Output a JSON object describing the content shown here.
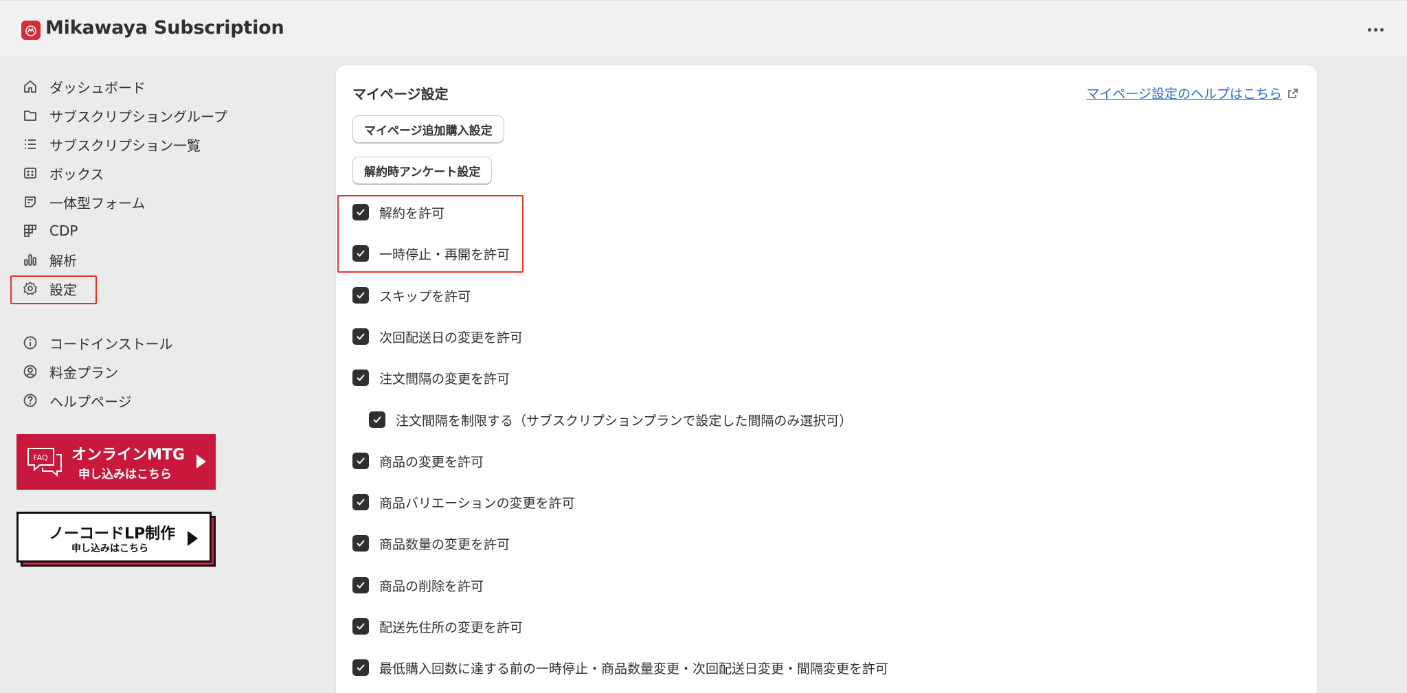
{
  "app": {
    "title": "Mikawaya Subscription",
    "accent_color": "#d32f3a"
  },
  "topbar": {
    "more_icon": "ellipsis-icon"
  },
  "sidebar": {
    "items": [
      {
        "label": "ダッシュボード",
        "icon": "home-icon"
      },
      {
        "label": "サブスクリプショングループ",
        "icon": "folder-icon"
      },
      {
        "label": "サブスクリプション一覧",
        "icon": "list-icon"
      },
      {
        "label": "ボックス",
        "icon": "box-icon"
      },
      {
        "label": "一体型フォーム",
        "icon": "form-icon"
      },
      {
        "label": "CDP",
        "icon": "grid-icon"
      },
      {
        "label": "解析",
        "icon": "bar-chart-icon"
      },
      {
        "label": "設定",
        "icon": "gear-icon",
        "highlighted": true
      },
      {
        "label": "コードインストール",
        "icon": "info-icon"
      },
      {
        "label": "料金プラン",
        "icon": "user-circle-icon"
      },
      {
        "label": "ヘルプページ",
        "icon": "question-icon"
      }
    ],
    "banners": {
      "mtg": {
        "line1": "オンラインMTG",
        "line2": "申し込みはこちら",
        "badge": "FAQ",
        "color": "#c8193c"
      },
      "lp": {
        "line1": "ノーコードLP制作",
        "line2": "申し込みはこちら"
      }
    }
  },
  "main": {
    "card_title": "マイページ設定",
    "help_link": "マイページ設定のヘルプはこちら",
    "buttons": {
      "additional_purchase": "マイページ追加購入設定",
      "cancel_survey": "解約時アンケート設定"
    },
    "checkboxes": [
      {
        "label": "解約を許可",
        "checked": true,
        "indent": 0
      },
      {
        "label": "一時停止・再開を許可",
        "checked": true,
        "indent": 0
      },
      {
        "label": "スキップを許可",
        "checked": true,
        "indent": 0
      },
      {
        "label": "次回配送日の変更を許可",
        "checked": true,
        "indent": 0
      },
      {
        "label": "注文間隔の変更を許可",
        "checked": true,
        "indent": 0
      },
      {
        "label": "注文間隔を制限する（サブスクリプションプランで設定した間隔のみ選択可）",
        "checked": true,
        "indent": 1
      },
      {
        "label": "商品の変更を許可",
        "checked": true,
        "indent": 0
      },
      {
        "label": "商品バリエーションの変更を許可",
        "checked": true,
        "indent": 0
      },
      {
        "label": "商品数量の変更を許可",
        "checked": true,
        "indent": 0
      },
      {
        "label": "商品の削除を許可",
        "checked": true,
        "indent": 0
      },
      {
        "label": "配送先住所の変更を許可",
        "checked": true,
        "indent": 0
      },
      {
        "label": "最低購入回数に達する前の一時停止・商品数量変更・次回配送日変更・間隔変更を許可",
        "checked": true,
        "indent": 0
      }
    ]
  }
}
